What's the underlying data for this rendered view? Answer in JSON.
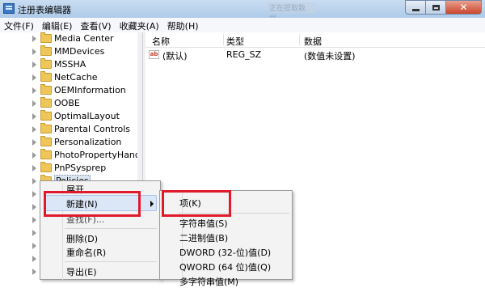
{
  "window": {
    "title": "注册表编辑器",
    "ghost_title": "正在提取数据...",
    "minimize_glyph": "",
    "close_glyph": "✕"
  },
  "menubar": {
    "items": [
      "文件(F)",
      "编辑(E)",
      "查看(V)",
      "收藏夹(A)",
      "帮助(H)"
    ]
  },
  "tree": {
    "items": [
      {
        "label": "Media Center"
      },
      {
        "label": "MMDevices"
      },
      {
        "label": "MSSHA"
      },
      {
        "label": "NetCache"
      },
      {
        "label": "OEMInformation"
      },
      {
        "label": "OOBE"
      },
      {
        "label": "OptimalLayout"
      },
      {
        "label": "Parental Controls"
      },
      {
        "label": "Personalization"
      },
      {
        "label": "PhotoPropertyHandl"
      },
      {
        "label": "PnPSysprep"
      },
      {
        "label": "Policies",
        "selected": true
      }
    ]
  },
  "list": {
    "columns": [
      "名称",
      "类型",
      "数据"
    ],
    "rows": [
      {
        "icon": "ab",
        "name": "(默认)",
        "type": "REG_SZ",
        "data": "(数值未设置)"
      }
    ]
  },
  "context_menu": {
    "items": [
      {
        "label": "展开"
      },
      {
        "label": "新建(N)",
        "highlighted": true,
        "has_submenu": true
      },
      {
        "label": "查找(F)..."
      },
      {
        "label": "删除(D)"
      },
      {
        "label": "重命名(R)"
      },
      {
        "label": "导出(E)"
      }
    ]
  },
  "submenu": {
    "items": [
      {
        "label": "项(K)"
      },
      {
        "label": "字符串值(S)"
      },
      {
        "label": "二进制值(B)"
      },
      {
        "label": "DWORD (32-位)值(D)"
      },
      {
        "label": "QWORD (64 位)值(Q)"
      },
      {
        "label": "多字符串值(M)"
      }
    ]
  },
  "colors": {
    "annotation_red": "#e0192b",
    "menu_highlight": "#dbe7f6",
    "selection": "#dce6f2"
  }
}
